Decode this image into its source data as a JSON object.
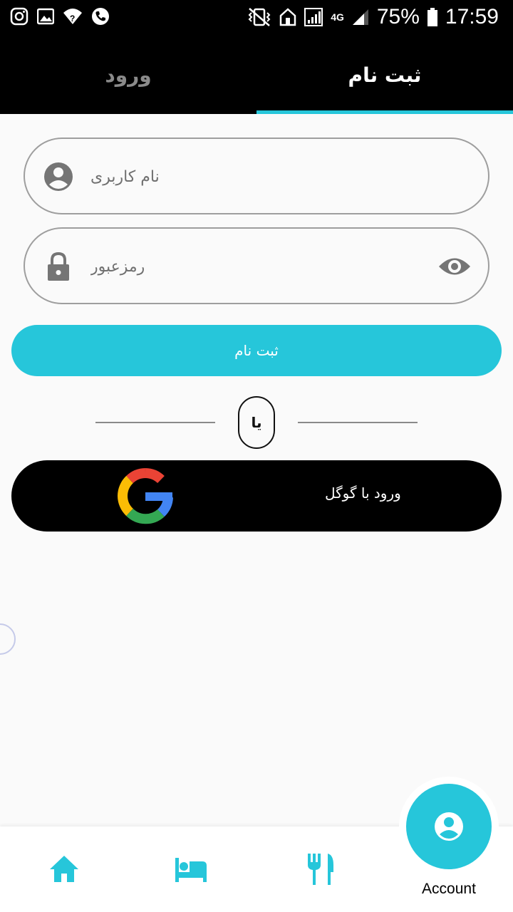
{
  "status_bar": {
    "battery_percent": "75%",
    "time": "17:59",
    "network": "4G",
    "left_icons": [
      "instagram-icon",
      "gallery-icon",
      "wifi-question-icon",
      "phone-icon"
    ],
    "right_icons": [
      "vibrate-mute-icon",
      "home-icon",
      "signal-icon",
      "4g-icon",
      "signal-icon",
      "battery-icon"
    ]
  },
  "tabs": {
    "signup_label": "ثبت نام",
    "login_label": "ورود",
    "active": "signup"
  },
  "form": {
    "username_placeholder": "نام کاربری",
    "password_placeholder": "رمزعبور",
    "signup_button": "ثبت نام",
    "or_label": "یا",
    "google_button": "ورود با گوگل"
  },
  "bottom_nav": {
    "items": [
      "home-icon",
      "hotel-icon",
      "restaurant-icon"
    ],
    "active_label": "Account"
  },
  "colors": {
    "accent": "#26c6da",
    "bar": "#000000",
    "background": "#fafafa",
    "field_border": "#9e9e9e",
    "icon_grey": "#757575"
  }
}
